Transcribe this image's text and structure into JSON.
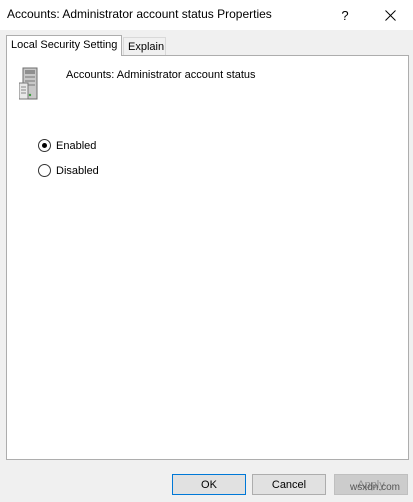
{
  "window": {
    "title": "Accounts: Administrator account status Properties",
    "help_symbol": "?",
    "close_icon": "close-icon"
  },
  "tabs": [
    {
      "label": "Local Security Setting",
      "active": true
    },
    {
      "label": "Explain",
      "active": false
    }
  ],
  "panel": {
    "icon": "server-icon",
    "policy_name": "Accounts: Administrator account status",
    "options": [
      {
        "label": "Enabled",
        "selected": true
      },
      {
        "label": "Disabled",
        "selected": false
      }
    ]
  },
  "buttons": {
    "ok": "OK",
    "cancel": "Cancel",
    "apply": "Apply"
  },
  "watermark": "wsxdn.com"
}
